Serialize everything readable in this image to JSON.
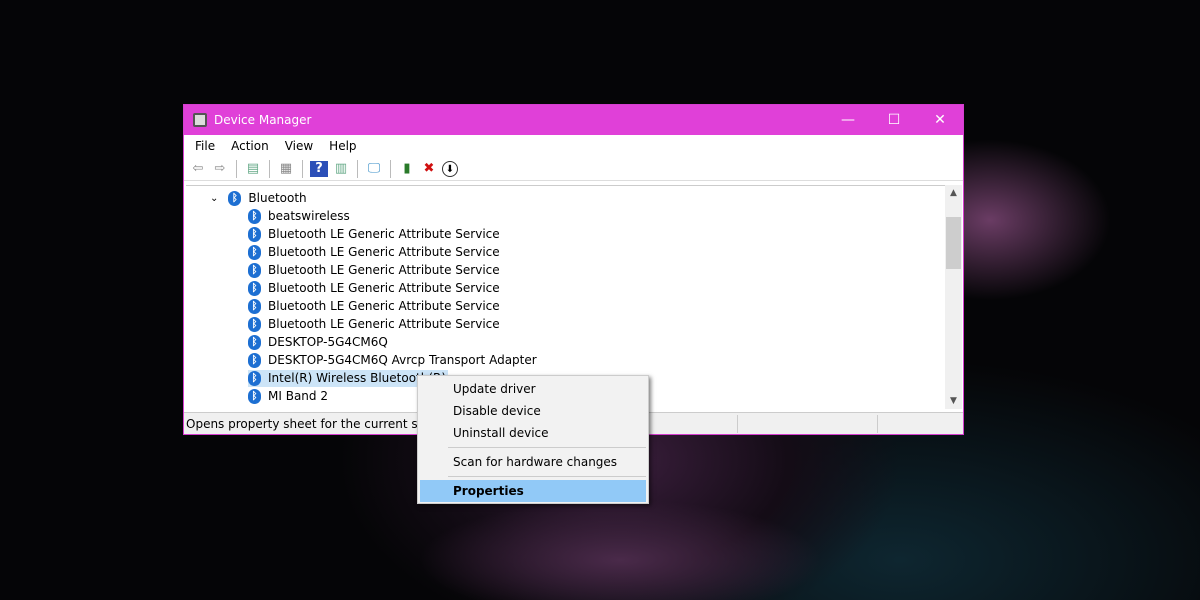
{
  "window": {
    "title": "Device Manager",
    "minimize": "—",
    "maximize": "☐",
    "close": "✕"
  },
  "menu": [
    "File",
    "Action",
    "View",
    "Help"
  ],
  "toolbar": [
    "back-icon",
    "forward-icon",
    "show-hide-console-tree-icon",
    "properties-icon",
    "help-icon",
    "action-pane-icon",
    "monitor-icon",
    "update-driver-icon",
    "uninstall-icon",
    "download-icon"
  ],
  "tree": {
    "category": "Bluetooth",
    "items": [
      "beatswireless",
      "Bluetooth LE Generic Attribute Service",
      "Bluetooth LE Generic Attribute Service",
      "Bluetooth LE Generic Attribute Service",
      "Bluetooth LE Generic Attribute Service",
      "Bluetooth LE Generic Attribute Service",
      "Bluetooth LE Generic Attribute Service",
      "DESKTOP-5G4CM6Q",
      "DESKTOP-5G4CM6Q Avrcp Transport Adapter",
      "Intel(R) Wireless Bluetooth(R)",
      "MI Band 2"
    ],
    "selected_index": 9
  },
  "status": "Opens property sheet for the current selection.",
  "context_menu": {
    "items": [
      "Update driver",
      "Disable device",
      "Uninstall device",
      "Scan for hardware changes",
      "Properties"
    ],
    "highlighted": "Properties"
  },
  "colors": {
    "title_bar": "#e040d8",
    "highlight": "#91c9f7",
    "bluetooth": "#1d6fd2"
  }
}
